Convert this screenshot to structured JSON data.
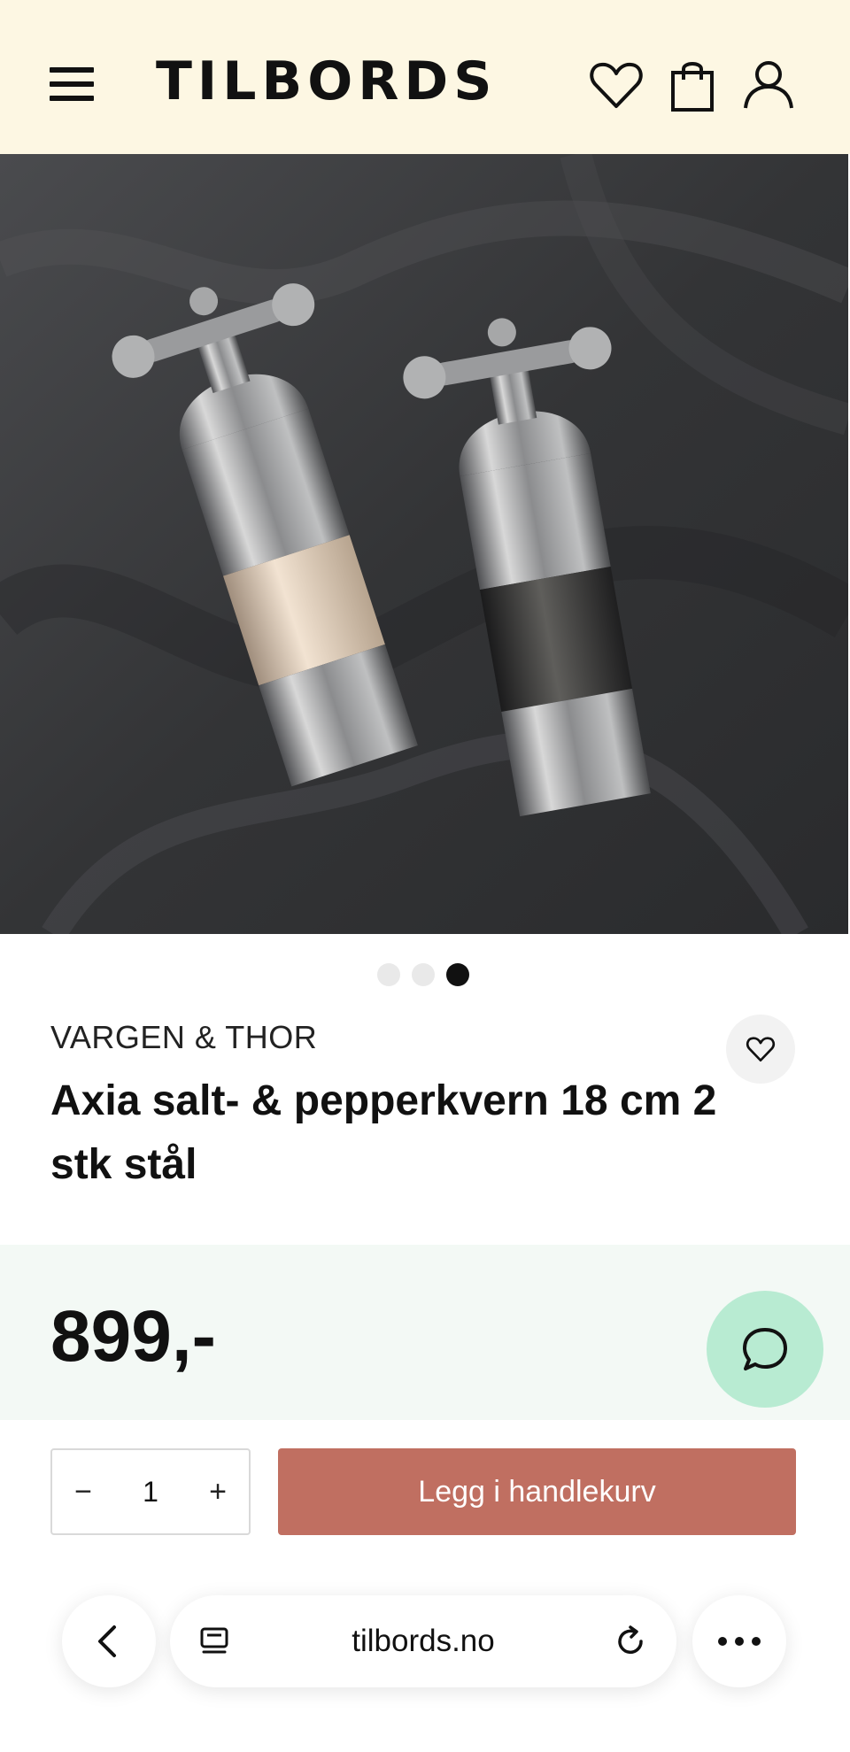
{
  "header": {
    "logo": "TILBORDS",
    "icons": [
      "menu-icon",
      "heart-icon",
      "shopping-bag-icon",
      "user-icon"
    ]
  },
  "gallery": {
    "total_images": 3,
    "active_index": 3
  },
  "product": {
    "brand": "VARGEN & THOR",
    "title": "Axia salt- & pepperkvern 18 cm 2 stk stål",
    "price": "899,-"
  },
  "cart": {
    "quantity_minus": "−",
    "quantity": "1",
    "quantity_plus": "+",
    "add_to_cart_label": "Legg i handlekurv"
  },
  "browser": {
    "url": "tilbords.no"
  },
  "colors": {
    "header_bg": "#fdf7e3",
    "price_band_bg": "#f3f9f5",
    "chat_button": "#b8ebd2",
    "add_to_cart": "#c06f61"
  }
}
